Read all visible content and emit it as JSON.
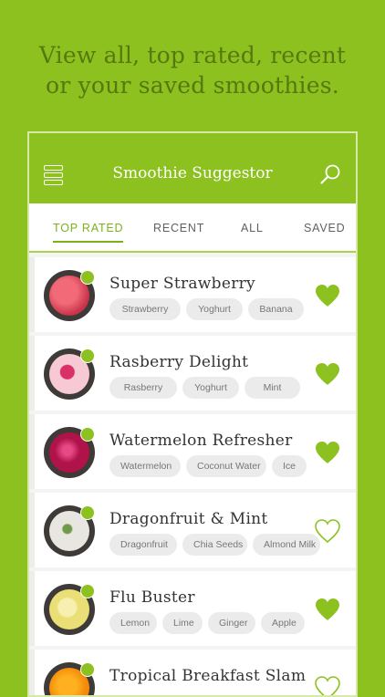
{
  "promo": {
    "line1": "View all, top rated, recent",
    "line2": "or your saved smoothies."
  },
  "app": {
    "title": "Smoothie Suggestor"
  },
  "icons": {
    "menu": "menu-icon",
    "search": "search-icon",
    "heart": "heart-icon"
  },
  "colors": {
    "brand": "#8cc11f",
    "accent": "#7db11b",
    "text_dark": "#56790f"
  },
  "tabs": [
    {
      "label": "TOP RATED",
      "active": true
    },
    {
      "label": "RECENT",
      "active": false
    },
    {
      "label": "ALL",
      "active": false
    },
    {
      "label": "SAVED",
      "active": false
    }
  ],
  "smoothies": [
    {
      "name": "Super Strawberry",
      "tags": [
        "Strawberry",
        "Yoghurt",
        "Banana"
      ],
      "saved": true
    },
    {
      "name": "Rasberry Delight",
      "tags": [
        "Rasberry",
        "Yoghurt",
        "Mint"
      ],
      "saved": true
    },
    {
      "name": "Watermelon Refresher",
      "tags": [
        "Watermelon",
        "Coconut Water",
        "Ice"
      ],
      "saved": true
    },
    {
      "name": "Dragonfruit & Mint",
      "tags": [
        "Dragonfruit",
        "Chia Seeds",
        "Almond Milk"
      ],
      "saved": false
    },
    {
      "name": "Flu Buster",
      "tags": [
        "Lemon",
        "Lime",
        "Ginger",
        "Apple"
      ],
      "saved": true
    },
    {
      "name": "Tropical Breakfast Slam",
      "tags": [],
      "saved": false
    }
  ]
}
